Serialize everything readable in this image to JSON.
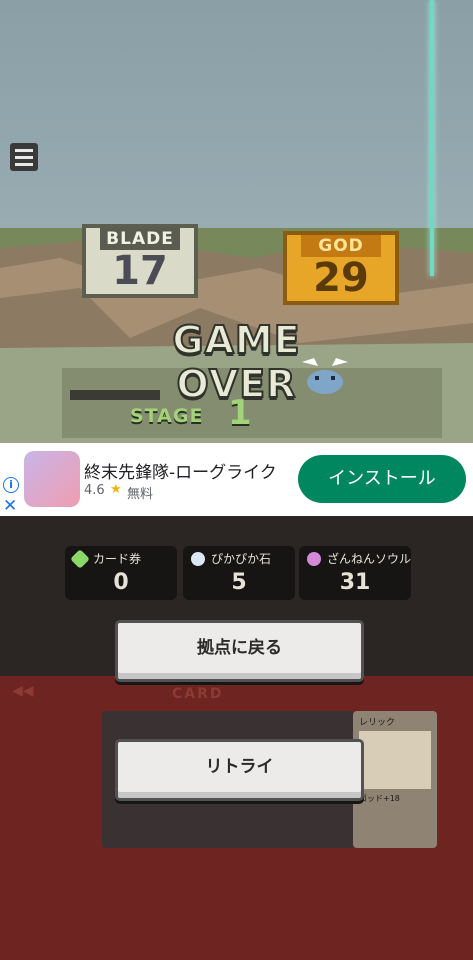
{
  "hud": {
    "menu_icon": "hamburger-menu-icon"
  },
  "scores": {
    "blade": {
      "title": "BLADE",
      "value": "17"
    },
    "god": {
      "title": "GOD",
      "value": "29"
    }
  },
  "result": {
    "title": "GAME OVER",
    "stage_label": "STAGE",
    "stage_value": "1"
  },
  "ad": {
    "title": "終末先鋒隊-ローグライク",
    "rating": "4.6",
    "star": "★",
    "price": "無料",
    "install_label": "インストール",
    "info_glyph": "i",
    "close_glyph": "✕"
  },
  "currencies": [
    {
      "label": "カード券",
      "value": "0"
    },
    {
      "label": "ぴかぴか石",
      "value": "5"
    },
    {
      "label": "ざんねんソウル",
      "value": "31"
    }
  ],
  "buttons": {
    "home": "拠点に戻る",
    "retry": "リトライ"
  },
  "background": {
    "card_label": "CARD",
    "relic_label": "レリック",
    "relic_sub": "ゴッド+18"
  },
  "colors": {
    "accent_teal": "#6fd9c3",
    "god_gold": "#e8a628",
    "install_green": "#01875f",
    "stage_green": "#a4d279"
  }
}
